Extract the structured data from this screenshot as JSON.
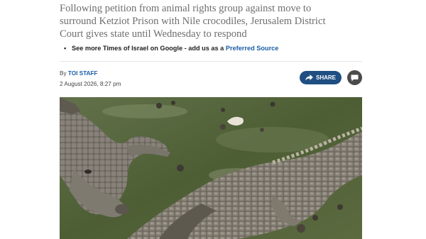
{
  "article": {
    "subtitle": "Following petition from animal rights group against move to surround Ketziot Prison with Nile crocodiles, Jerusalem District Court gives state until Wednesday to respond",
    "more_prefix": "See more Times of Israel on Google - add us as a ",
    "more_link": "Preferred Source",
    "bullet": "•",
    "byline_prefix": "By ",
    "author": "TOI STAFF",
    "date": "2 August 2026, 8:27 pm"
  },
  "actions": {
    "share_label": "SHARE",
    "share_icon": "share-arrow-icon",
    "comment_icon": "comment-icon"
  },
  "photo": {
    "subject": "crocodile-photo",
    "colors": {
      "water": "#5a6b3e",
      "croc": "#6f6a5f",
      "button": "#1f4f82",
      "link": "#1a5fa6"
    }
  }
}
